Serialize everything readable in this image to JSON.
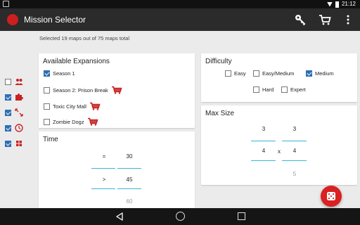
{
  "status_bar": {
    "time": "21:12"
  },
  "app_bar": {
    "title": "Mission Selector",
    "actions": [
      "key-icon",
      "cart-icon",
      "more-icon"
    ]
  },
  "summary": "Selected 19 maps out of 75 maps total",
  "sidebar": {
    "items": [
      {
        "icon": "group-icon",
        "checked": false
      },
      {
        "icon": "puzzle-icon",
        "checked": true
      },
      {
        "icon": "expand-arrows-icon",
        "checked": true
      },
      {
        "icon": "clock-icon",
        "checked": true
      },
      {
        "icon": "grid-icon",
        "checked": true
      }
    ]
  },
  "expansions": {
    "title": "Available Expansions",
    "items": [
      {
        "label": "Season 1",
        "checked": true,
        "cart": false
      },
      {
        "label": "Season 2: Prison Break",
        "checked": false,
        "cart": true
      },
      {
        "label": "Toxic City Mall",
        "checked": false,
        "cart": true
      },
      {
        "label": "Zombie Dogz",
        "checked": false,
        "cart": true
      }
    ]
  },
  "time": {
    "title": "Time",
    "operator_top": "=",
    "operator_selected": ">",
    "value_top": "30",
    "value_selected": "45",
    "value_bottom": "60"
  },
  "difficulty": {
    "title": "Difficulty",
    "options": [
      {
        "label": "Easy",
        "checked": false
      },
      {
        "label": "Easy/Medium",
        "checked": false
      },
      {
        "label": "Medium",
        "checked": true
      },
      {
        "label": "Hard",
        "checked": false
      },
      {
        "label": "Expert",
        "checked": false
      }
    ]
  },
  "max_size": {
    "title": "Max Size",
    "width_top": "3",
    "height_top": "3",
    "width_selected": "4",
    "separator": "x",
    "height_selected": "4",
    "height_bottom": "5"
  },
  "colors": {
    "accent": "#2e6fb5",
    "brand_red": "#cc1f1f",
    "underline": "#38b6d8"
  }
}
